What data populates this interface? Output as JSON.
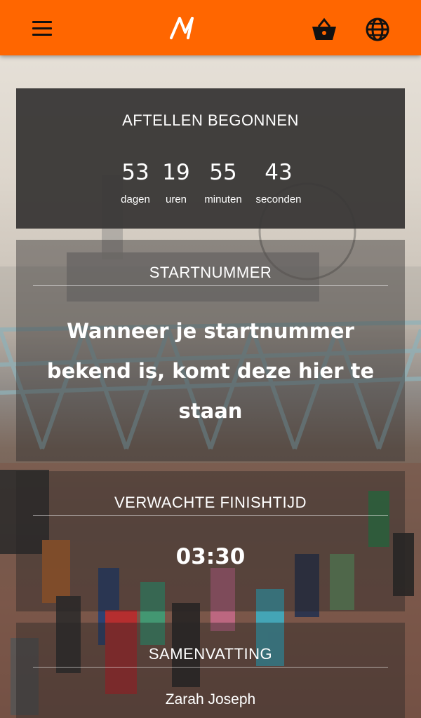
{
  "header": {
    "menu_icon": "hamburger-menu-icon",
    "logo_icon": "brand-logo-icon",
    "cart_icon": "shopping-basket-icon",
    "language_icon": "globe-icon",
    "background_color": "#ff6600"
  },
  "countdown": {
    "title": "AFTELLEN BEGONNEN",
    "units": [
      {
        "value": "53",
        "label": "dagen"
      },
      {
        "value": "19",
        "label": "uren"
      },
      {
        "value": "55",
        "label": "minuten"
      },
      {
        "value": "43",
        "label": "seconden"
      }
    ]
  },
  "start_number": {
    "title": "STARTNUMMER",
    "message": "Wanneer je startnummer bekend is, komt deze hier te staan"
  },
  "finish_time": {
    "title": "VERWACHTE FINISHTIJD",
    "value": "03:30"
  },
  "summary": {
    "title": "SAMENVATTING",
    "name": "Zarah Joseph"
  }
}
